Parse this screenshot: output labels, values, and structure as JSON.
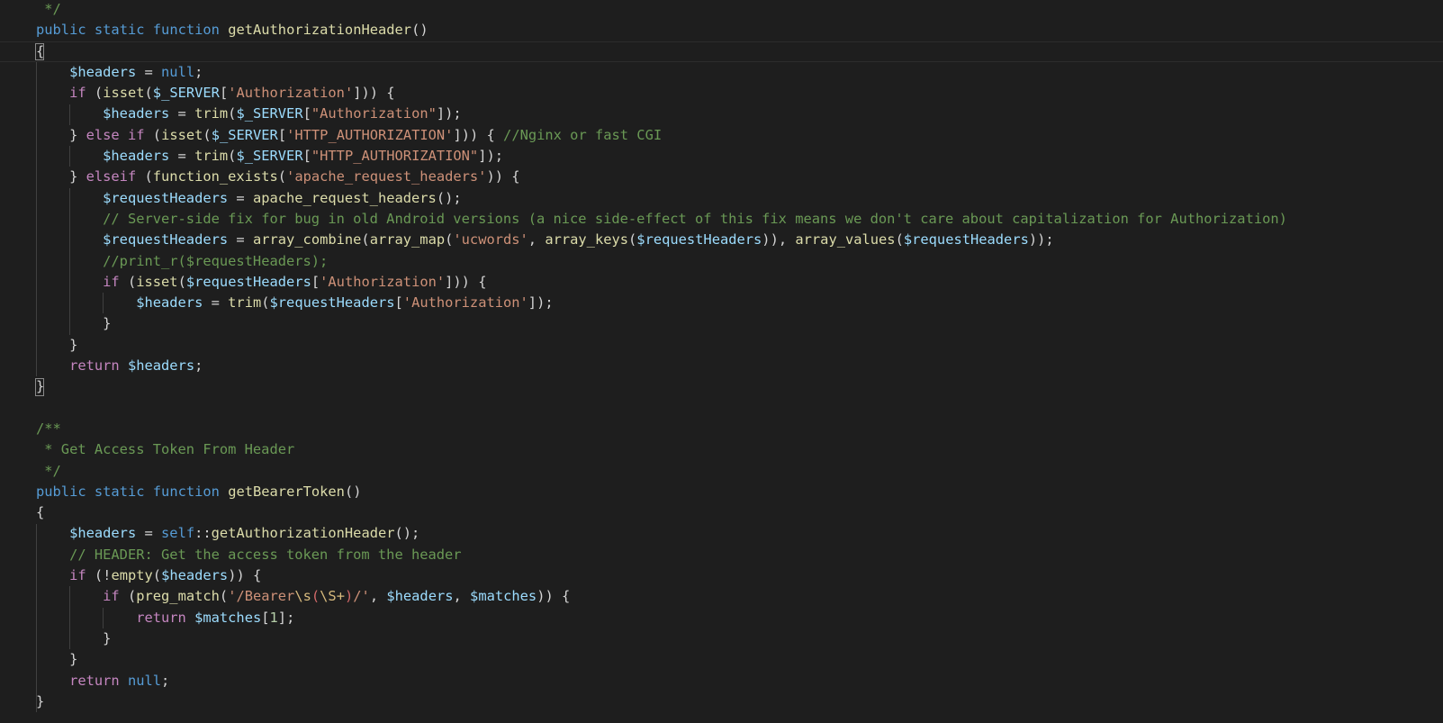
{
  "theme": {
    "background": "#1e1e1e",
    "default": "#d4d4d4",
    "keyword": "#569cd6",
    "control": "#c586c0",
    "function": "#dcdcaa",
    "variable": "#9cdcfe",
    "string": "#ce9178",
    "comment": "#6a9955",
    "number": "#b5cea8",
    "regex": "#d16969",
    "escape": "#d7ba7d"
  },
  "lines": [
    {
      "tokens": [
        {
          "t": " */",
          "c": "comment"
        }
      ]
    },
    {
      "tokens": [
        {
          "t": "public",
          "c": "keyword"
        },
        {
          "t": " ",
          "c": "default"
        },
        {
          "t": "static",
          "c": "keyword"
        },
        {
          "t": " ",
          "c": "default"
        },
        {
          "t": "function",
          "c": "keyword"
        },
        {
          "t": " ",
          "c": "default"
        },
        {
          "t": "getAuthorizationHeader",
          "c": "function"
        },
        {
          "t": "()",
          "c": "default"
        }
      ]
    },
    {
      "current": true,
      "tokens": [
        {
          "t": "{",
          "c": "default"
        }
      ]
    },
    {
      "tokens": [
        {
          "t": "    ",
          "c": "default"
        },
        {
          "t": "$headers",
          "c": "variable"
        },
        {
          "t": " = ",
          "c": "default"
        },
        {
          "t": "null",
          "c": "keyword"
        },
        {
          "t": ";",
          "c": "default"
        }
      ]
    },
    {
      "tokens": [
        {
          "t": "    ",
          "c": "default"
        },
        {
          "t": "if",
          "c": "control"
        },
        {
          "t": " (",
          "c": "default"
        },
        {
          "t": "isset",
          "c": "function"
        },
        {
          "t": "(",
          "c": "default"
        },
        {
          "t": "$_SERVER",
          "c": "variable"
        },
        {
          "t": "[",
          "c": "default"
        },
        {
          "t": "'Authorization'",
          "c": "string"
        },
        {
          "t": "])) {",
          "c": "default"
        }
      ]
    },
    {
      "tokens": [
        {
          "t": "        ",
          "c": "default"
        },
        {
          "t": "$headers",
          "c": "variable"
        },
        {
          "t": " = ",
          "c": "default"
        },
        {
          "t": "trim",
          "c": "function"
        },
        {
          "t": "(",
          "c": "default"
        },
        {
          "t": "$_SERVER",
          "c": "variable"
        },
        {
          "t": "[",
          "c": "default"
        },
        {
          "t": "\"Authorization\"",
          "c": "string"
        },
        {
          "t": "]);",
          "c": "default"
        }
      ]
    },
    {
      "tokens": [
        {
          "t": "    } ",
          "c": "default"
        },
        {
          "t": "else",
          "c": "control"
        },
        {
          "t": " ",
          "c": "default"
        },
        {
          "t": "if",
          "c": "control"
        },
        {
          "t": " (",
          "c": "default"
        },
        {
          "t": "isset",
          "c": "function"
        },
        {
          "t": "(",
          "c": "default"
        },
        {
          "t": "$_SERVER",
          "c": "variable"
        },
        {
          "t": "[",
          "c": "default"
        },
        {
          "t": "'HTTP_AUTHORIZATION'",
          "c": "string"
        },
        {
          "t": "])) { ",
          "c": "default"
        },
        {
          "t": "//Nginx or fast CGI",
          "c": "comment"
        }
      ]
    },
    {
      "tokens": [
        {
          "t": "        ",
          "c": "default"
        },
        {
          "t": "$headers",
          "c": "variable"
        },
        {
          "t": " = ",
          "c": "default"
        },
        {
          "t": "trim",
          "c": "function"
        },
        {
          "t": "(",
          "c": "default"
        },
        {
          "t": "$_SERVER",
          "c": "variable"
        },
        {
          "t": "[",
          "c": "default"
        },
        {
          "t": "\"HTTP_AUTHORIZATION\"",
          "c": "string"
        },
        {
          "t": "]);",
          "c": "default"
        }
      ]
    },
    {
      "tokens": [
        {
          "t": "    } ",
          "c": "default"
        },
        {
          "t": "elseif",
          "c": "control"
        },
        {
          "t": " (",
          "c": "default"
        },
        {
          "t": "function_exists",
          "c": "function"
        },
        {
          "t": "(",
          "c": "default"
        },
        {
          "t": "'apache_request_headers'",
          "c": "string"
        },
        {
          "t": ")) {",
          "c": "default"
        }
      ]
    },
    {
      "tokens": [
        {
          "t": "        ",
          "c": "default"
        },
        {
          "t": "$requestHeaders",
          "c": "variable"
        },
        {
          "t": " = ",
          "c": "default"
        },
        {
          "t": "apache_request_headers",
          "c": "function"
        },
        {
          "t": "();",
          "c": "default"
        }
      ]
    },
    {
      "tokens": [
        {
          "t": "        ",
          "c": "default"
        },
        {
          "t": "// Server-side fix for bug in old Android versions (a nice side-effect of this fix means we don't care about capitalization for Authorization)",
          "c": "comment"
        }
      ]
    },
    {
      "tokens": [
        {
          "t": "        ",
          "c": "default"
        },
        {
          "t": "$requestHeaders",
          "c": "variable"
        },
        {
          "t": " = ",
          "c": "default"
        },
        {
          "t": "array_combine",
          "c": "function"
        },
        {
          "t": "(",
          "c": "default"
        },
        {
          "t": "array_map",
          "c": "function"
        },
        {
          "t": "(",
          "c": "default"
        },
        {
          "t": "'ucwords'",
          "c": "string"
        },
        {
          "t": ", ",
          "c": "default"
        },
        {
          "t": "array_keys",
          "c": "function"
        },
        {
          "t": "(",
          "c": "default"
        },
        {
          "t": "$requestHeaders",
          "c": "variable"
        },
        {
          "t": ")), ",
          "c": "default"
        },
        {
          "t": "array_values",
          "c": "function"
        },
        {
          "t": "(",
          "c": "default"
        },
        {
          "t": "$requestHeaders",
          "c": "variable"
        },
        {
          "t": "));",
          "c": "default"
        }
      ]
    },
    {
      "tokens": [
        {
          "t": "        ",
          "c": "default"
        },
        {
          "t": "//print_r($requestHeaders);",
          "c": "comment"
        }
      ]
    },
    {
      "tokens": [
        {
          "t": "        ",
          "c": "default"
        },
        {
          "t": "if",
          "c": "control"
        },
        {
          "t": " (",
          "c": "default"
        },
        {
          "t": "isset",
          "c": "function"
        },
        {
          "t": "(",
          "c": "default"
        },
        {
          "t": "$requestHeaders",
          "c": "variable"
        },
        {
          "t": "[",
          "c": "default"
        },
        {
          "t": "'Authorization'",
          "c": "string"
        },
        {
          "t": "])) {",
          "c": "default"
        }
      ]
    },
    {
      "tokens": [
        {
          "t": "            ",
          "c": "default"
        },
        {
          "t": "$headers",
          "c": "variable"
        },
        {
          "t": " = ",
          "c": "default"
        },
        {
          "t": "trim",
          "c": "function"
        },
        {
          "t": "(",
          "c": "default"
        },
        {
          "t": "$requestHeaders",
          "c": "variable"
        },
        {
          "t": "[",
          "c": "default"
        },
        {
          "t": "'Authorization'",
          "c": "string"
        },
        {
          "t": "]);",
          "c": "default"
        }
      ]
    },
    {
      "tokens": [
        {
          "t": "        }",
          "c": "default"
        }
      ]
    },
    {
      "tokens": [
        {
          "t": "    }",
          "c": "default"
        }
      ]
    },
    {
      "tokens": [
        {
          "t": "    ",
          "c": "default"
        },
        {
          "t": "return",
          "c": "control"
        },
        {
          "t": " ",
          "c": "default"
        },
        {
          "t": "$headers",
          "c": "variable"
        },
        {
          "t": ";",
          "c": "default"
        }
      ]
    },
    {
      "tokens": [
        {
          "t": "}",
          "c": "default"
        }
      ]
    },
    {
      "tokens": []
    },
    {
      "tokens": [
        {
          "t": "/**",
          "c": "comment"
        }
      ]
    },
    {
      "tokens": [
        {
          "t": " * Get Access Token From Header",
          "c": "comment"
        }
      ]
    },
    {
      "tokens": [
        {
          "t": " */",
          "c": "comment"
        }
      ]
    },
    {
      "tokens": [
        {
          "t": "public",
          "c": "keyword"
        },
        {
          "t": " ",
          "c": "default"
        },
        {
          "t": "static",
          "c": "keyword"
        },
        {
          "t": " ",
          "c": "default"
        },
        {
          "t": "function",
          "c": "keyword"
        },
        {
          "t": " ",
          "c": "default"
        },
        {
          "t": "getBearerToken",
          "c": "function"
        },
        {
          "t": "()",
          "c": "default"
        }
      ]
    },
    {
      "tokens": [
        {
          "t": "{",
          "c": "default"
        }
      ]
    },
    {
      "tokens": [
        {
          "t": "    ",
          "c": "default"
        },
        {
          "t": "$headers",
          "c": "variable"
        },
        {
          "t": " = ",
          "c": "default"
        },
        {
          "t": "self",
          "c": "keyword"
        },
        {
          "t": "::",
          "c": "default"
        },
        {
          "t": "getAuthorizationHeader",
          "c": "function"
        },
        {
          "t": "();",
          "c": "default"
        }
      ]
    },
    {
      "tokens": [
        {
          "t": "    ",
          "c": "default"
        },
        {
          "t": "// HEADER: Get the access token from the header",
          "c": "comment"
        }
      ]
    },
    {
      "tokens": [
        {
          "t": "    ",
          "c": "default"
        },
        {
          "t": "if",
          "c": "control"
        },
        {
          "t": " (!",
          "c": "default"
        },
        {
          "t": "empty",
          "c": "function"
        },
        {
          "t": "(",
          "c": "default"
        },
        {
          "t": "$headers",
          "c": "variable"
        },
        {
          "t": ")) {",
          "c": "default"
        }
      ]
    },
    {
      "tokens": [
        {
          "t": "        ",
          "c": "default"
        },
        {
          "t": "if",
          "c": "control"
        },
        {
          "t": " (",
          "c": "default"
        },
        {
          "t": "preg_match",
          "c": "function"
        },
        {
          "t": "(",
          "c": "default"
        },
        {
          "t": "'/Bearer",
          "c": "string"
        },
        {
          "t": "\\s",
          "c": "escape"
        },
        {
          "t": "(",
          "c": "regex"
        },
        {
          "t": "\\S",
          "c": "escape"
        },
        {
          "t": "+",
          "c": "escape"
        },
        {
          "t": ")",
          "c": "regex"
        },
        {
          "t": "/'",
          "c": "string"
        },
        {
          "t": ", ",
          "c": "default"
        },
        {
          "t": "$headers",
          "c": "variable"
        },
        {
          "t": ", ",
          "c": "default"
        },
        {
          "t": "$matches",
          "c": "variable"
        },
        {
          "t": ")) {",
          "c": "default"
        }
      ]
    },
    {
      "tokens": [
        {
          "t": "            ",
          "c": "default"
        },
        {
          "t": "return",
          "c": "control"
        },
        {
          "t": " ",
          "c": "default"
        },
        {
          "t": "$matches",
          "c": "variable"
        },
        {
          "t": "[",
          "c": "default"
        },
        {
          "t": "1",
          "c": "number"
        },
        {
          "t": "];",
          "c": "default"
        }
      ]
    },
    {
      "tokens": [
        {
          "t": "        }",
          "c": "default"
        }
      ]
    },
    {
      "tokens": [
        {
          "t": "    }",
          "c": "default"
        }
      ]
    },
    {
      "tokens": [
        {
          "t": "    ",
          "c": "default"
        },
        {
          "t": "return",
          "c": "control"
        },
        {
          "t": " ",
          "c": "default"
        },
        {
          "t": "null",
          "c": "keyword"
        },
        {
          "t": ";",
          "c": "default"
        }
      ]
    },
    {
      "tokens": [
        {
          "t": "}",
          "c": "default"
        }
      ]
    }
  ]
}
